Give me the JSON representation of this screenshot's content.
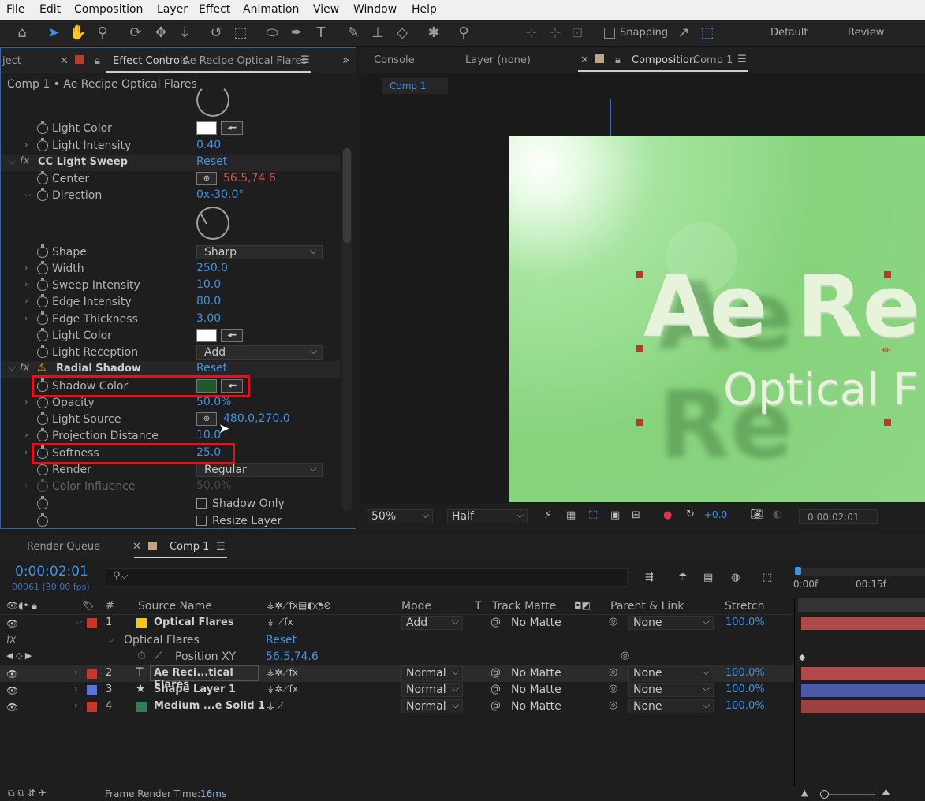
{
  "menu": [
    "File",
    "Edit",
    "Composition",
    "Layer",
    "Effect",
    "Animation",
    "View",
    "Window",
    "Help"
  ],
  "toolbar": {
    "snapping": "Snapping",
    "workspace_default": "Default",
    "workspace_review": "Review"
  },
  "effect_panel": {
    "tab_project": "ject",
    "tab_title": "Effect Controls",
    "tab_layer": "Ae Recipe Optical Flares",
    "breadcrumb": "Comp 1 • Ae Recipe Optical Flares",
    "rows": {
      "light_color_1": "Light Color",
      "light_intensity": "Light Intensity",
      "light_intensity_val": "0.40",
      "cc_light_sweep": "CC Light Sweep",
      "reset_1": "Reset",
      "center": "Center",
      "center_val": "56.5,74.6",
      "direction": "Direction",
      "direction_val": "0x-30.0°",
      "shape": "Shape",
      "shape_val": "Sharp",
      "width": "Width",
      "width_val": "250.0",
      "sweep_intensity": "Sweep Intensity",
      "sweep_intensity_val": "10.0",
      "edge_intensity": "Edge Intensity",
      "edge_intensity_val": "80.0",
      "edge_thickness": "Edge Thickness",
      "edge_thickness_val": "3.00",
      "light_color_2": "Light Color",
      "light_reception": "Light Reception",
      "light_reception_val": "Add",
      "radial_shadow": "Radial Shadow",
      "reset_2": "Reset",
      "shadow_color": "Shadow Color",
      "opacity": "Opacity",
      "opacity_val": "50.0%",
      "light_source": "Light Source",
      "light_source_val": "480.0,270.0",
      "projection_distance": "Projection Distance",
      "projection_distance_val": "10.0",
      "softness": "Softness",
      "softness_val": "25.0",
      "render": "Render",
      "render_val": "Regular",
      "color_influence": "Color Influence",
      "color_influence_val": "50.0%",
      "shadow_only": "Shadow Only",
      "resize_layer": "Resize Layer"
    },
    "colors": {
      "shadow_color": "#1f5a2a",
      "light_color": "#ffffff"
    }
  },
  "comp_panel": {
    "tab_console": "Console",
    "tab_layer": "Layer (none)",
    "tab_composition": "Composition",
    "tab_comp": "Comp 1",
    "subtab": "Comp 1",
    "title_text": "Ae Re",
    "subtitle_text": "Optical F",
    "zoom": "50%",
    "resolution": "Half",
    "exposure": "+0.0",
    "timecode": "0:00:02:01"
  },
  "timeline": {
    "tab_render_queue": "Render Queue",
    "tab_comp": "Comp 1",
    "current_time": "0:00:02:01",
    "frames_fps": "00061 (30.00 fps)",
    "ruler": [
      "0:00f",
      "00:15f"
    ],
    "headers": {
      "num": "#",
      "source": "Source Name",
      "mode": "Mode",
      "t": "T",
      "track_matte": "Track Matte",
      "parent": "Parent & Link",
      "stretch": "Stretch"
    },
    "layers": [
      {
        "num": "1",
        "name": "Optical Flares",
        "mode": "Add",
        "matte": "No Matte",
        "parent": "None",
        "stretch": "100.0%",
        "label": "#c0392b",
        "swatch": "#f5c518",
        "bar": "#b04a4a"
      },
      {
        "num": "2",
        "name": "Ae Reci...tical Flares",
        "mode": "Normal",
        "matte": "No Matte",
        "parent": "None",
        "stretch": "100.0%",
        "label": "#c0392b",
        "swatch": "",
        "bar": "#b04a4a"
      },
      {
        "num": "3",
        "name": "Shape Layer 1",
        "mode": "Normal",
        "matte": "No Matte",
        "parent": "None",
        "stretch": "100.0%",
        "label": "#5b73d6",
        "swatch": "",
        "bar": "#4a5aa8"
      },
      {
        "num": "4",
        "name": "Medium ...e Solid 1",
        "mode": "Normal",
        "matte": "No Matte",
        "parent": "None",
        "stretch": "100.0%",
        "label": "#c0392b",
        "swatch": "#2e7d5b",
        "bar": "#9c4040"
      }
    ],
    "sub_effect": "Optical Flares",
    "sub_reset": "Reset",
    "sub_prop": "Position XY",
    "sub_val": "56.5,74.6",
    "status": "Frame Render Time:",
    "status_val": "16ms"
  }
}
